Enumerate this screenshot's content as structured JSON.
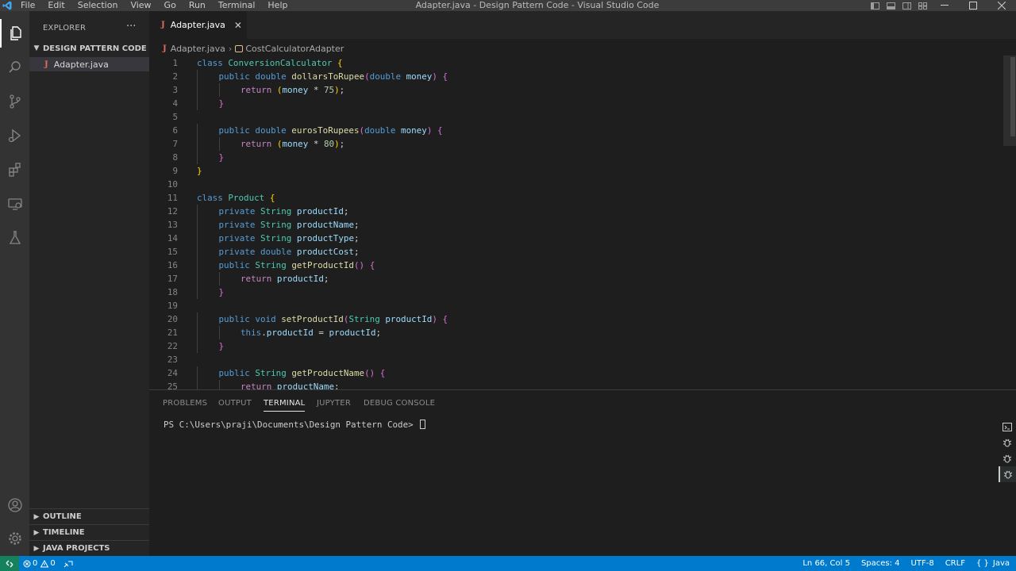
{
  "menu": [
    "File",
    "Edit",
    "Selection",
    "View",
    "Go",
    "Run",
    "Terminal",
    "Help"
  ],
  "window_title": "Adapter.java - Design Pattern Code - Visual Studio Code",
  "sidebar": {
    "title": "EXPLORER",
    "folder": "DESIGN PATTERN CODE",
    "file": "Adapter.java",
    "sections": [
      "OUTLINE",
      "TIMELINE",
      "JAVA PROJECTS"
    ]
  },
  "tab": {
    "label": "Adapter.java",
    "icon": "J"
  },
  "breadcrumb": {
    "file": "Adapter.java",
    "symbol": "CostCalculatorAdapter"
  },
  "code_lines": [
    {
      "n": "1",
      "indent": 0,
      "t": [
        [
          "kw",
          "class "
        ],
        [
          "cls",
          "ConversionCalculator "
        ],
        [
          "br1",
          "{"
        ]
      ]
    },
    {
      "n": "2",
      "indent": 1,
      "t": [
        [
          "kw",
          "public double "
        ],
        [
          "fn",
          "dollarsToRupee"
        ],
        [
          "br2",
          "("
        ],
        [
          "kw",
          "double "
        ],
        [
          "pm",
          "money"
        ],
        [
          "br2",
          ")"
        ],
        [
          "pl",
          " "
        ],
        [
          "br2",
          "{"
        ]
      ]
    },
    {
      "n": "3",
      "indent": 2,
      "t": [
        [
          "kw2",
          "return "
        ],
        [
          "br1",
          "("
        ],
        [
          "pm",
          "money"
        ],
        [
          "pl",
          " * "
        ],
        [
          "num",
          "75"
        ],
        [
          "br1",
          ")"
        ],
        [
          "pl",
          ";"
        ]
      ]
    },
    {
      "n": "4",
      "indent": 1,
      "t": [
        [
          "br2",
          "}"
        ]
      ]
    },
    {
      "n": "5",
      "indent": 0,
      "t": []
    },
    {
      "n": "6",
      "indent": 1,
      "t": [
        [
          "kw",
          "public double "
        ],
        [
          "fn",
          "eurosToRupees"
        ],
        [
          "br2",
          "("
        ],
        [
          "kw",
          "double "
        ],
        [
          "pm",
          "money"
        ],
        [
          "br2",
          ")"
        ],
        [
          "pl",
          " "
        ],
        [
          "br2",
          "{"
        ]
      ]
    },
    {
      "n": "7",
      "indent": 2,
      "t": [
        [
          "kw2",
          "return "
        ],
        [
          "br1",
          "("
        ],
        [
          "pm",
          "money"
        ],
        [
          "pl",
          " * "
        ],
        [
          "num",
          "80"
        ],
        [
          "br1",
          ")"
        ],
        [
          "pl",
          ";"
        ]
      ]
    },
    {
      "n": "8",
      "indent": 1,
      "t": [
        [
          "br2",
          "}"
        ]
      ]
    },
    {
      "n": "9",
      "indent": 0,
      "t": [
        [
          "br1",
          "}"
        ]
      ]
    },
    {
      "n": "10",
      "indent": 0,
      "t": []
    },
    {
      "n": "11",
      "indent": 0,
      "t": [
        [
          "kw",
          "class "
        ],
        [
          "cls",
          "Product "
        ],
        [
          "br1",
          "{"
        ]
      ]
    },
    {
      "n": "12",
      "indent": 1,
      "t": [
        [
          "kw",
          "private "
        ],
        [
          "cls",
          "String "
        ],
        [
          "pm",
          "productId"
        ],
        [
          "pl",
          ";"
        ]
      ]
    },
    {
      "n": "13",
      "indent": 1,
      "t": [
        [
          "kw",
          "private "
        ],
        [
          "cls",
          "String "
        ],
        [
          "pm",
          "productName"
        ],
        [
          "pl",
          ";"
        ]
      ]
    },
    {
      "n": "14",
      "indent": 1,
      "t": [
        [
          "kw",
          "private "
        ],
        [
          "cls",
          "String "
        ],
        [
          "pm",
          "productType"
        ],
        [
          "pl",
          ";"
        ]
      ]
    },
    {
      "n": "15",
      "indent": 1,
      "t": [
        [
          "kw",
          "private double "
        ],
        [
          "pm",
          "productCost"
        ],
        [
          "pl",
          ";"
        ]
      ]
    },
    {
      "n": "16",
      "indent": 1,
      "t": [
        [
          "kw",
          "public "
        ],
        [
          "cls",
          "String "
        ],
        [
          "fn",
          "getProductId"
        ],
        [
          "br2",
          "()"
        ],
        [
          "pl",
          " "
        ],
        [
          "br2",
          "{"
        ]
      ]
    },
    {
      "n": "17",
      "indent": 2,
      "t": [
        [
          "kw2",
          "return "
        ],
        [
          "pm",
          "productId"
        ],
        [
          "pl",
          ";"
        ]
      ]
    },
    {
      "n": "18",
      "indent": 1,
      "t": [
        [
          "br2",
          "}"
        ]
      ]
    },
    {
      "n": "19",
      "indent": 0,
      "t": []
    },
    {
      "n": "20",
      "indent": 1,
      "t": [
        [
          "kw",
          "public void "
        ],
        [
          "fn",
          "setProductId"
        ],
        [
          "br2",
          "("
        ],
        [
          "cls",
          "String "
        ],
        [
          "pm",
          "productId"
        ],
        [
          "br2",
          ")"
        ],
        [
          "pl",
          " "
        ],
        [
          "br2",
          "{"
        ]
      ]
    },
    {
      "n": "21",
      "indent": 2,
      "t": [
        [
          "kw",
          "this"
        ],
        [
          "pl",
          "."
        ],
        [
          "pm",
          "productId"
        ],
        [
          "pl",
          " = "
        ],
        [
          "pm",
          "productId"
        ],
        [
          "pl",
          ";"
        ]
      ]
    },
    {
      "n": "22",
      "indent": 1,
      "t": [
        [
          "br2",
          "}"
        ]
      ]
    },
    {
      "n": "23",
      "indent": 0,
      "t": []
    },
    {
      "n": "24",
      "indent": 1,
      "t": [
        [
          "kw",
          "public "
        ],
        [
          "cls",
          "String "
        ],
        [
          "fn",
          "getProductName"
        ],
        [
          "br2",
          "()"
        ],
        [
          "pl",
          " "
        ],
        [
          "br2",
          "{"
        ]
      ]
    },
    {
      "n": "25",
      "indent": 2,
      "t": [
        [
          "kw2",
          "return "
        ],
        [
          "pm",
          "productName"
        ],
        [
          "pl",
          ";"
        ]
      ]
    }
  ],
  "panel": {
    "tabs": [
      "PROBLEMS",
      "OUTPUT",
      "TERMINAL",
      "JUPYTER",
      "DEBUG CONSOLE"
    ],
    "active_tab": "TERMINAL",
    "terminal_prompt": "PS C:\\Users\\praji\\Documents\\Design Pattern Code> "
  },
  "statusbar": {
    "errors": "0",
    "warnings": "0",
    "position": "Ln 66, Col 5",
    "spaces": "Spaces: 4",
    "encoding": "UTF-8",
    "eol": "CRLF",
    "language": "Java",
    "language_icon": "{ }"
  },
  "colors": {
    "titlebar": "#3c3c3c",
    "activitybar": "#333333",
    "sidebar": "#252526",
    "editor": "#1e1e1e",
    "statusbar": "#007acc",
    "java_icon": "#e06c5d"
  }
}
